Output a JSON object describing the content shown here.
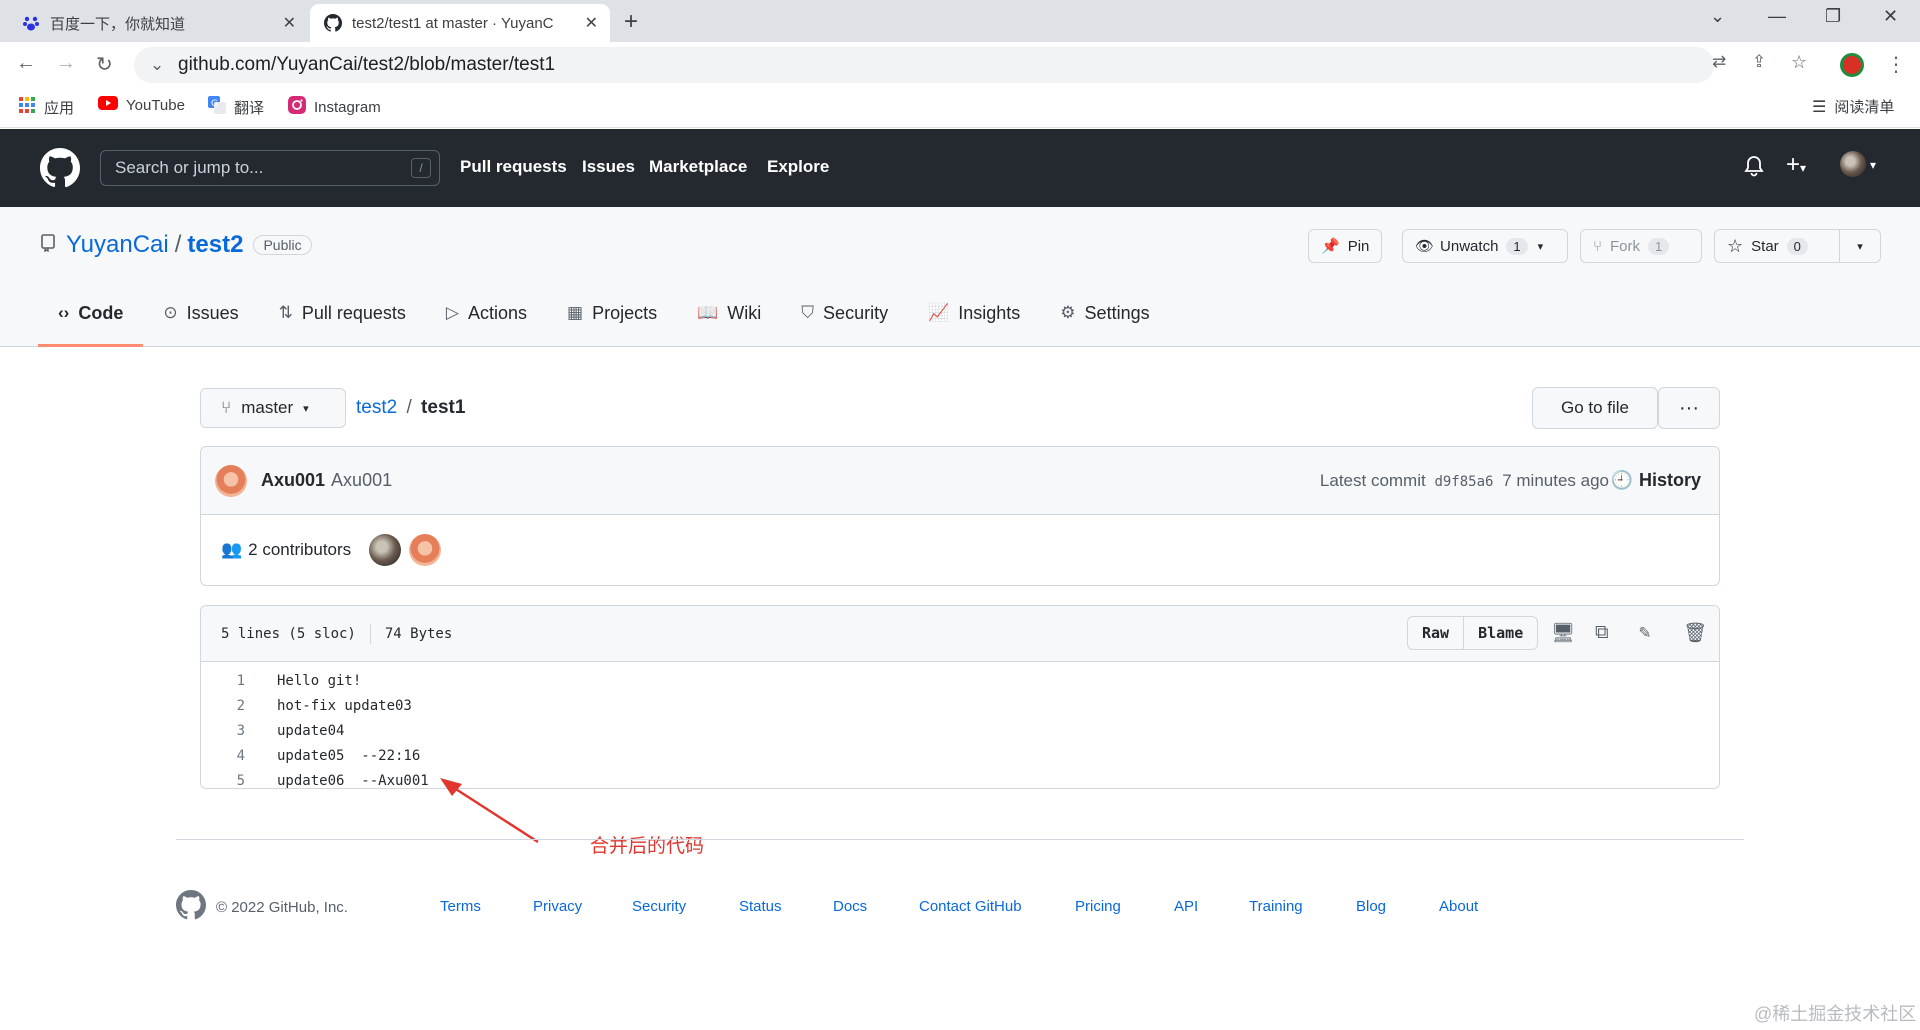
{
  "browser": {
    "tabs": [
      {
        "title": "百度一下，你就知道",
        "active": false
      },
      {
        "title": "test2/test1 at master · YuyanC",
        "active": true
      }
    ],
    "url": "github.com/YuyanCai/test2/blob/master/test1",
    "bookmarks": [
      "应用",
      "YouTube",
      "翻译",
      "Instagram"
    ],
    "reading_list": "阅读清单"
  },
  "github": {
    "search_placeholder": "Search or jump to...",
    "slash_key": "/",
    "nav": [
      "Pull requests",
      "Issues",
      "Marketplace",
      "Explore"
    ]
  },
  "repo": {
    "owner": "YuyanCai",
    "sep": "/",
    "name": "test2",
    "visibility": "Public",
    "actions": {
      "pin": "Pin",
      "unwatch": "Unwatch",
      "unwatch_count": "1",
      "fork": "Fork",
      "fork_count": "1",
      "star": "Star",
      "star_count": "0"
    },
    "tabs": [
      "Code",
      "Issues",
      "Pull requests",
      "Actions",
      "Projects",
      "Wiki",
      "Security",
      "Insights",
      "Settings"
    ]
  },
  "file": {
    "branch": "master",
    "crumb_repo": "test2",
    "crumb_sep": "/",
    "crumb_file": "test1",
    "go_to_file": "Go to file",
    "more": "···",
    "commit": {
      "author_login": "Axu001",
      "author_name": "Axu001",
      "latest_label": "Latest commit",
      "sha": "d9f85a6",
      "time": "7 minutes ago",
      "history": "History"
    },
    "contributors": "2 contributors",
    "stats_lines": "5 lines (5 sloc)",
    "stats_size": "74 Bytes",
    "raw": "Raw",
    "blame": "Blame",
    "lines": [
      {
        "n": "1",
        "code": "Hello git!"
      },
      {
        "n": "2",
        "code": "hot-fix update03"
      },
      {
        "n": "3",
        "code": "update04"
      },
      {
        "n": "4",
        "code": "update05  --22:16"
      },
      {
        "n": "5",
        "code": "update06  --Axu001"
      }
    ]
  },
  "annotation": "合并后的代码",
  "footer": {
    "copyright": "© 2022 GitHub, Inc.",
    "links": [
      "Terms",
      "Privacy",
      "Security",
      "Status",
      "Docs",
      "Contact GitHub",
      "Pricing",
      "API",
      "Training",
      "Blog",
      "About"
    ]
  },
  "watermark": "@稀土掘金技术社区"
}
